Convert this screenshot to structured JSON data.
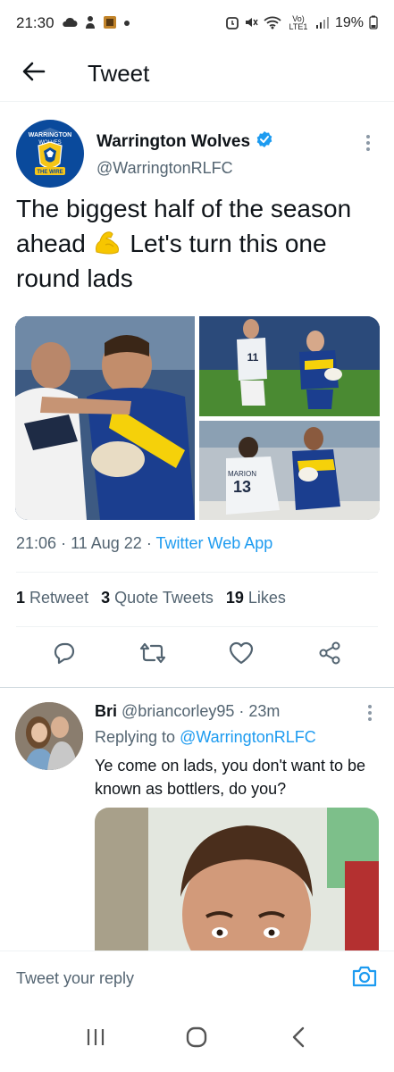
{
  "status_bar": {
    "time": "21:30",
    "network": "Vo) LTE1",
    "battery": "19%",
    "icons": [
      "cloud-icon",
      "person-icon",
      "app-icon",
      "dot-icon",
      "alarm-icon",
      "mute-icon",
      "wifi-icon",
      "signal-icon",
      "battery-icon"
    ]
  },
  "app_bar": {
    "back_icon": "arrow-left-icon",
    "title": "Tweet"
  },
  "tweet": {
    "author_name": "Warrington Wolves",
    "verified": true,
    "handle": "@WarringtonRLFC",
    "avatar_text_top": "WARRINGTON",
    "avatar_text_mid": "WOLVES",
    "avatar_text_bottom": "THE WIRE",
    "text_part1": "The biggest half of the season ahead ",
    "text_part2": " Let's turn this one round lads",
    "emoji": "flexed-biceps",
    "media": [
      {
        "desc": "player-photo-1",
        "number": ""
      },
      {
        "desc": "player-photo-2",
        "number": "11"
      },
      {
        "desc": "player-photo-3",
        "number": "13",
        "name": "MARION"
      }
    ],
    "time": "21:06",
    "date": "11 Aug 22",
    "source": "Twitter Web App",
    "retweets_count": "1",
    "retweets_label": "Retweet",
    "quotes_count": "3",
    "quotes_label": "Quote Tweets",
    "likes_count": "19",
    "likes_label": "Likes",
    "actions": [
      "reply-icon",
      "retweet-icon",
      "like-icon",
      "share-icon"
    ]
  },
  "reply": {
    "name": "Bri",
    "handle": "@briancorley95",
    "time": "23m",
    "replying_label": "Replying to",
    "replying_to": "@WarringtonRLFC",
    "text": "Ye come on lads, you don't want to be known as bottlers, do you?"
  },
  "composer": {
    "placeholder": "Tweet your reply",
    "camera_icon": "camera-icon"
  },
  "nav": [
    "recents-icon",
    "home-icon",
    "back-icon"
  ],
  "colors": {
    "accent": "#1d9bf0",
    "text": "#0f1419",
    "secondary": "#536471",
    "brand_blue": "#0a4a9c",
    "brand_yellow": "#f5c518"
  }
}
